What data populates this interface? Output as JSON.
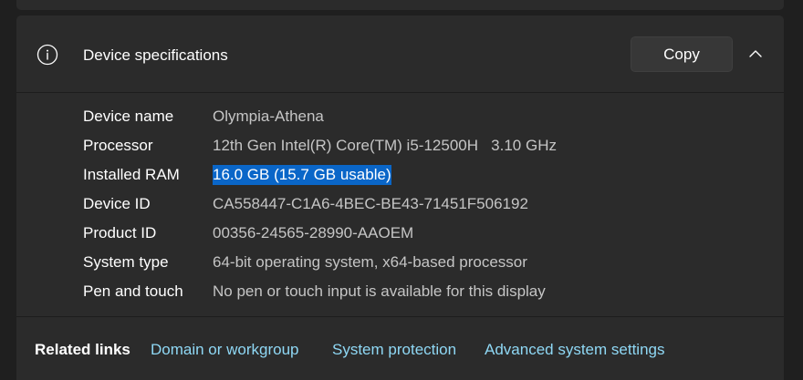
{
  "device_specifications": {
    "title": "Device specifications",
    "icon": "info-icon",
    "copy_label": "Copy",
    "collapse_icon": "chevron-up-icon",
    "specs": [
      {
        "label": "Device name",
        "value": "Olympia-Athena",
        "selected": false
      },
      {
        "label": "Processor",
        "value": "12th Gen Intel(R) Core(TM) i5-12500H   3.10 GHz",
        "selected": false
      },
      {
        "label": "Installed RAM",
        "value": "16.0 GB (15.7 GB usable)",
        "selected": true
      },
      {
        "label": "Device ID",
        "value": "CA558447-C1A6-4BEC-BE43-71451F506192",
        "selected": false
      },
      {
        "label": "Product ID",
        "value": "00356-24565-28990-AAOEM",
        "selected": false
      },
      {
        "label": "System type",
        "value": "64-bit operating system, x64-based processor",
        "selected": false
      },
      {
        "label": "Pen and touch",
        "value": "No pen or touch input is available for this display",
        "selected": false
      }
    ]
  },
  "related_links": {
    "title": "Related links",
    "links": [
      "Domain or workgroup",
      "System protection",
      "Advanced system settings"
    ]
  },
  "colors": {
    "background": "#1f1f1f",
    "card": "#2b2b2b",
    "link": "#8fd8f5",
    "selection": "#0a66c8"
  }
}
